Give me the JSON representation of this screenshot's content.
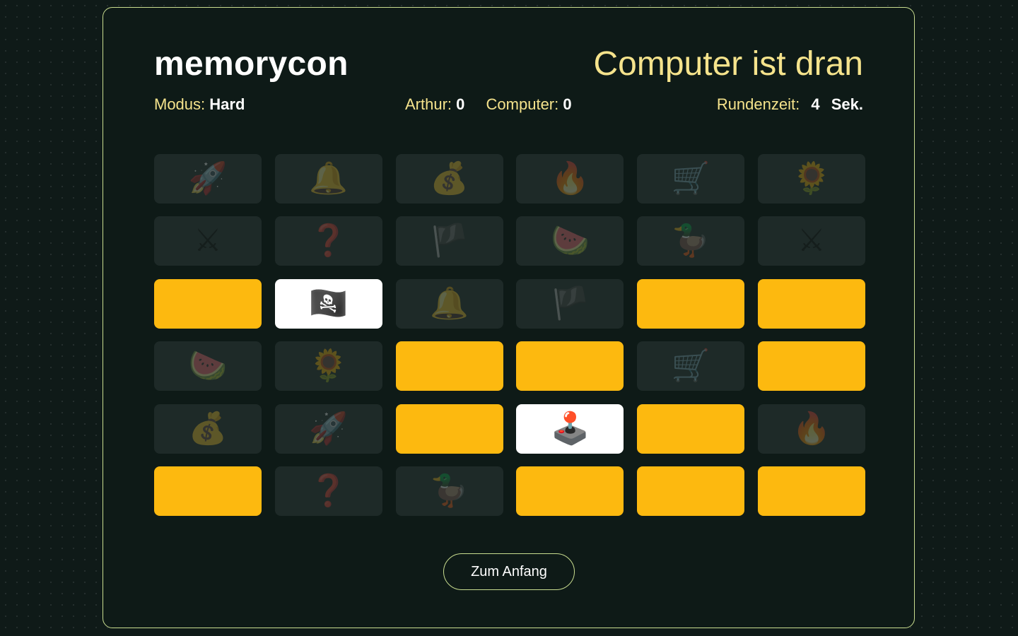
{
  "app": {
    "title": "memorycon",
    "turn_text": "Computer ist dran"
  },
  "stats": {
    "mode_label": "Modus:",
    "mode_value": "Hard",
    "player1_label": "Arthur:",
    "player1_score": "0",
    "player2_label": "Computer:",
    "player2_score": "0",
    "timer_label": "Rundenzeit:",
    "timer_value": "4",
    "timer_unit": "Sek."
  },
  "colors": {
    "card_back": "#fdb90f",
    "card_matched": "#1e2a28",
    "card_open": "#ffffff",
    "accent_text": "#f5e38c",
    "border": "#c9dd8f"
  },
  "board": {
    "rows": 6,
    "cols": 6,
    "cards": [
      {
        "state": "matched",
        "icon": "rocket-icon",
        "glyph": "🚀"
      },
      {
        "state": "matched",
        "icon": "bell-icon",
        "glyph": "🔔"
      },
      {
        "state": "matched",
        "icon": "money-bag-icon",
        "glyph": "💰"
      },
      {
        "state": "matched",
        "icon": "fire-icon",
        "glyph": "🔥"
      },
      {
        "state": "matched",
        "icon": "shopping-cart-icon",
        "glyph": "🛒"
      },
      {
        "state": "matched",
        "icon": "sunflower-icon",
        "glyph": "🌻"
      },
      {
        "state": "matched",
        "icon": "crossed-swords-icon",
        "glyph": "⚔"
      },
      {
        "state": "matched",
        "icon": "question-mark-icon",
        "glyph": "❓"
      },
      {
        "state": "matched",
        "icon": "pirate-flag-icon",
        "glyph": "🏴"
      },
      {
        "state": "matched",
        "icon": "watermelon-icon",
        "glyph": "🍉"
      },
      {
        "state": "matched",
        "icon": "duck-icon",
        "glyph": "🦆"
      },
      {
        "state": "matched",
        "icon": "crossed-swords-icon",
        "glyph": "⚔"
      },
      {
        "state": "hidden",
        "icon": "",
        "glyph": ""
      },
      {
        "state": "open",
        "icon": "pirate-flag-icon",
        "glyph": "🏴‍☠️"
      },
      {
        "state": "matched",
        "icon": "bell-icon",
        "glyph": "🔔"
      },
      {
        "state": "matched",
        "icon": "pirate-flag-icon",
        "glyph": "🏴"
      },
      {
        "state": "hidden",
        "icon": "",
        "glyph": ""
      },
      {
        "state": "hidden",
        "icon": "",
        "glyph": ""
      },
      {
        "state": "matched",
        "icon": "watermelon-icon",
        "glyph": "🍉"
      },
      {
        "state": "matched",
        "icon": "sunflower-icon",
        "glyph": "🌻"
      },
      {
        "state": "hidden",
        "icon": "",
        "glyph": ""
      },
      {
        "state": "hidden",
        "icon": "",
        "glyph": ""
      },
      {
        "state": "matched",
        "icon": "shopping-cart-icon",
        "glyph": "🛒"
      },
      {
        "state": "hidden",
        "icon": "",
        "glyph": ""
      },
      {
        "state": "matched",
        "icon": "money-bag-icon",
        "glyph": "💰"
      },
      {
        "state": "matched",
        "icon": "rocket-icon",
        "glyph": "🚀"
      },
      {
        "state": "hidden",
        "icon": "",
        "glyph": ""
      },
      {
        "state": "open",
        "icon": "joystick-icon",
        "glyph": "🕹️"
      },
      {
        "state": "hidden",
        "icon": "",
        "glyph": ""
      },
      {
        "state": "matched",
        "icon": "fire-icon",
        "glyph": "🔥"
      },
      {
        "state": "hidden",
        "icon": "",
        "glyph": ""
      },
      {
        "state": "matched",
        "icon": "question-mark-icon",
        "glyph": "❓"
      },
      {
        "state": "matched",
        "icon": "duck-icon",
        "glyph": "🦆"
      },
      {
        "state": "hidden",
        "icon": "",
        "glyph": ""
      },
      {
        "state": "hidden",
        "icon": "",
        "glyph": ""
      },
      {
        "state": "hidden",
        "icon": "",
        "glyph": ""
      }
    ]
  },
  "actions": {
    "restart_label": "Zum Anfang"
  }
}
